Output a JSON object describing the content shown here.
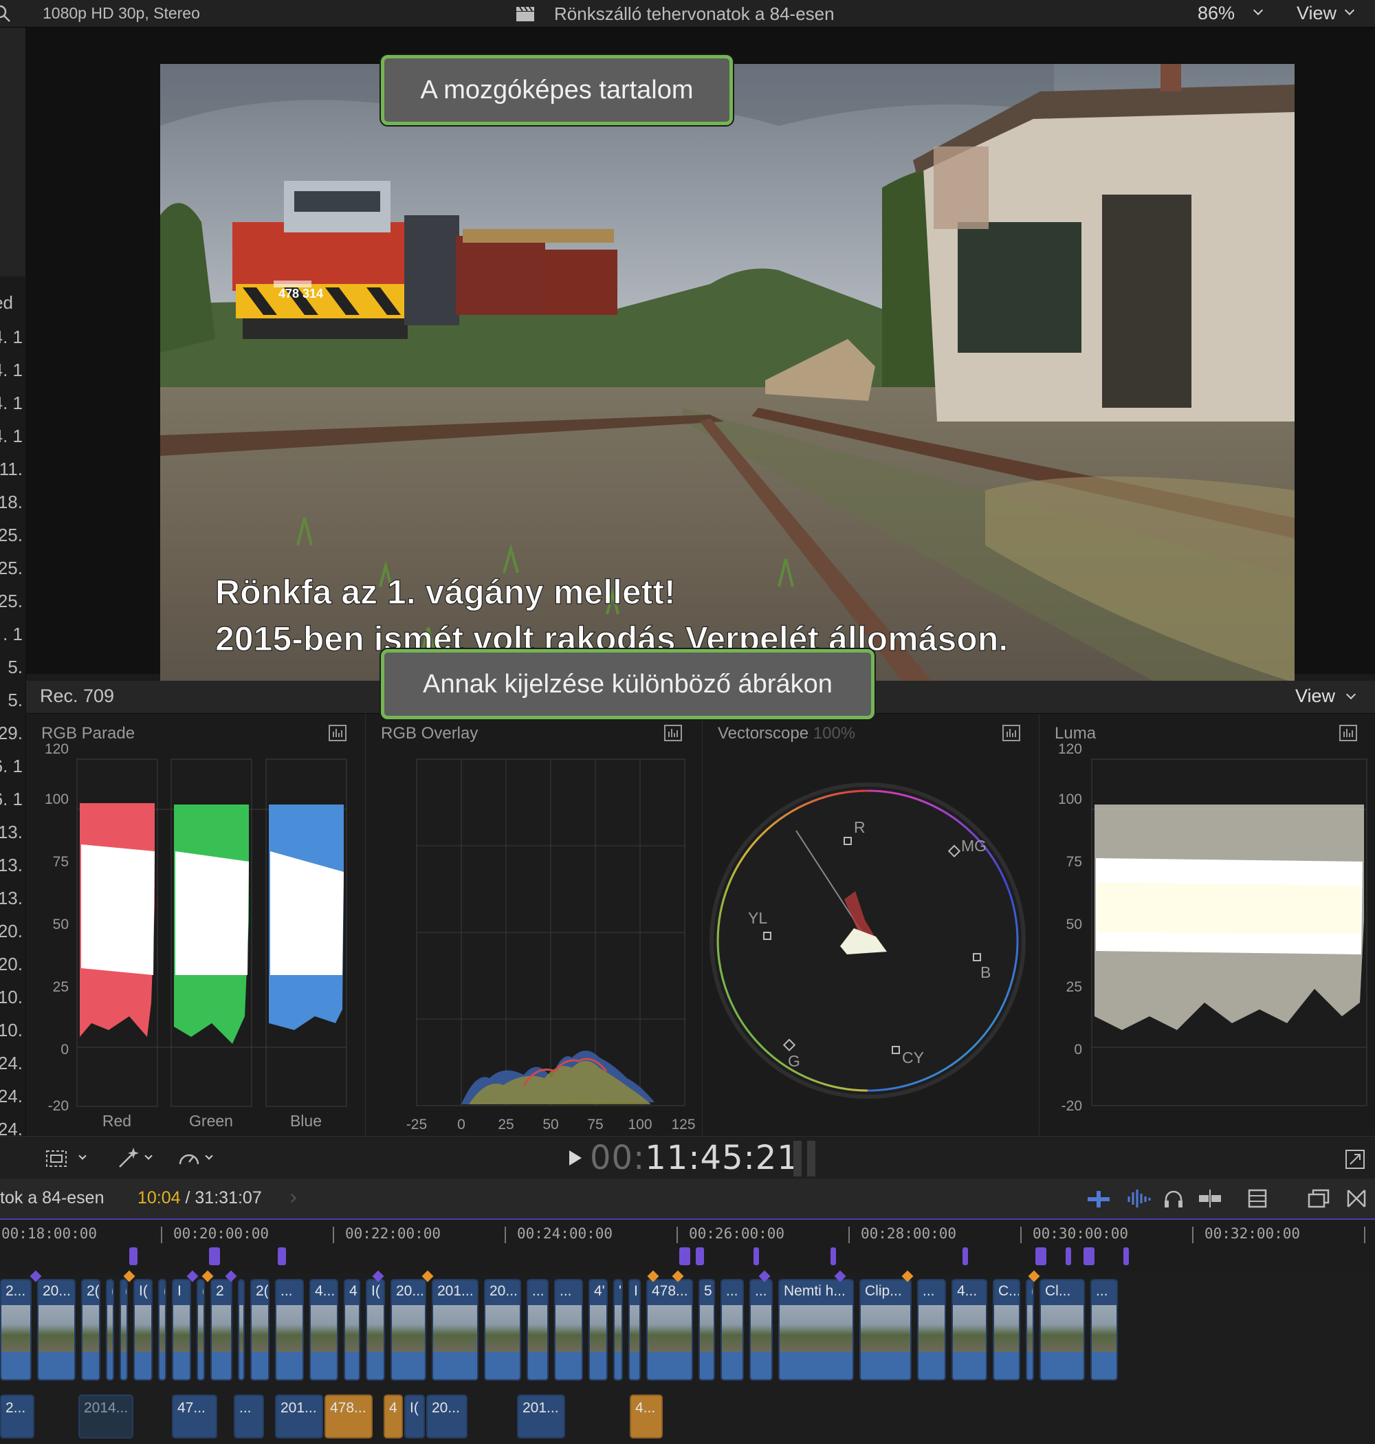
{
  "topbar": {
    "format": "1080p HD 30p, Stereo",
    "title": "Rönkszálló tehervonatok a 84-esen",
    "zoom": "86%",
    "view": "View"
  },
  "left_list": {
    "header": "ed",
    "items": [
      "4. 1",
      "4. 1",
      "4. 1",
      "4. 1",
      "11.",
      "18.",
      "25.",
      "25.",
      "25.",
      ". 1",
      "5.",
      "5.",
      "29.",
      "6. 1",
      "6. 1",
      "13.",
      "13.",
      "13.",
      "20.",
      "20.",
      "10.",
      "10.",
      "24.",
      "24.",
      "24."
    ]
  },
  "viewer": {
    "locomotive_number": "478 314",
    "subtitle_line1": "Rönkfa az 1. vágány mellett!",
    "subtitle_line2": "2015-ben ismét volt rakodás Verpelét állomáson."
  },
  "callouts": {
    "top": "A mozgóképes tartalom",
    "bottom": "Annak kijelzése különböző ábrákon"
  },
  "scopes": {
    "standard": "Rec. 709",
    "view": "View",
    "panels": [
      {
        "title": "RGB Parade",
        "y_ticks": [
          "120",
          "100",
          "75",
          "50",
          "25",
          "0",
          "-20"
        ],
        "channels": [
          "Red",
          "Green",
          "Blue"
        ]
      },
      {
        "title": "RGB Overlay",
        "x_ticks": [
          "-25",
          "0",
          "25",
          "50",
          "75",
          "100",
          "125"
        ]
      },
      {
        "title": "Vectorscope",
        "scale": "100%",
        "targets": [
          "R",
          "MG",
          "YL",
          "B",
          "G",
          "CY"
        ]
      },
      {
        "title": "Luma",
        "y_ticks": [
          "120",
          "100",
          "75",
          "50",
          "25",
          "0",
          "-20"
        ]
      }
    ]
  },
  "transport": {
    "timecode_dim": "00:",
    "timecode": "11:45:21"
  },
  "timeline": {
    "project": "tok a 84-esen",
    "current": "10:04",
    "total": "/ 31:31:07",
    "ruler": [
      "00:18:00:00",
      "00:20:00:00",
      "00:22:00:00",
      "00:24:00:00",
      "00:26:00:00",
      "00:28:00:00",
      "00:30:00:00",
      "00:32:00:00"
    ],
    "primary_clips": [
      "2...",
      "20...",
      "2(",
      "(",
      "(",
      "I(",
      "(",
      "I",
      "(",
      "2",
      "I",
      "2(",
      "...",
      "4...",
      "4",
      "I(",
      "20...",
      "201...",
      "20...",
      "...",
      "...",
      "4'",
      "'",
      "I",
      "478...",
      "5",
      "...",
      "...",
      "Nemti h...",
      "Clip...",
      "...",
      "4...",
      "C...",
      "(",
      "Cl...",
      "..."
    ],
    "secondary_clips": [
      {
        "label": "2...",
        "style": "blue"
      },
      {
        "label": "2014...",
        "style": "dark"
      },
      {
        "label": "47...",
        "style": "blue"
      },
      {
        "label": "...",
        "style": "blue"
      },
      {
        "label": "201...",
        "style": "blue"
      },
      {
        "label": "478...",
        "style": "orange"
      },
      {
        "label": "4",
        "style": "orange"
      },
      {
        "label": "I(",
        "style": "blue"
      },
      {
        "label": "20...",
        "style": "blue"
      },
      {
        "label": "201...",
        "style": "blue"
      },
      {
        "label": "4...",
        "style": "orange"
      }
    ],
    "colors": {
      "accent": "#4a3fb0",
      "clip": "#2b4a78",
      "clip_orange": "#b57c2e",
      "playhead_timecode": "#e0b422"
    }
  }
}
